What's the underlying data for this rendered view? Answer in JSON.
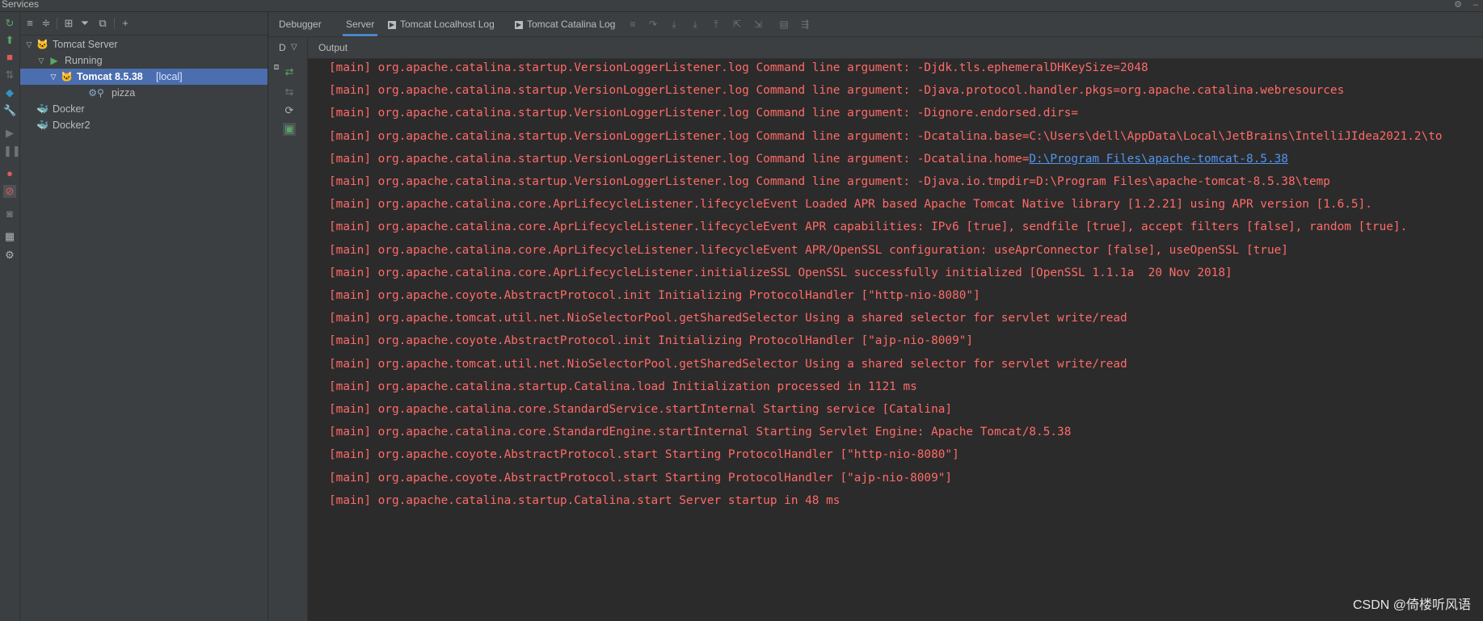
{
  "window": {
    "title": "Services"
  },
  "left_strip": {
    "icons": [
      "rerun-icon",
      "deploy-icon",
      "stop-icon",
      "update-icon",
      "jump-icon",
      "wrench-icon",
      "resume-icon",
      "pause-icon",
      "coverage-icon",
      "profiler-icon",
      "camera-icon",
      "layout-icon",
      "settings-icon"
    ]
  },
  "tree_toolbar": {
    "icons": [
      "expand-all-icon",
      "collapse-all-icon",
      "group-icon",
      "filter-icon",
      "new-tab-icon",
      "add-icon"
    ]
  },
  "tree": {
    "tomcat_server": "Tomcat Server",
    "running": "Running",
    "tomcat_instance": "Tomcat 8.5.38",
    "tomcat_instance_suffix": "[local]",
    "artifact": "pizza",
    "docker": "Docker",
    "docker2": "Docker2"
  },
  "tabs": {
    "debugger": "Debugger",
    "server": "Server",
    "localhost_log": "Tomcat Localhost Log",
    "catalina_log": "Tomcat Catalina Log"
  },
  "subbar": {
    "deployment_label": "D",
    "output_label": "Output"
  },
  "console": {
    "prefix": "[main] ",
    "lines": [
      "org.apache.catalina.startup.VersionLoggerListener.log Command line argument: -Djdk.tls.ephemeralDHKeySize=2048",
      "org.apache.catalina.startup.VersionLoggerListener.log Command line argument: -Djava.protocol.handler.pkgs=org.apache.catalina.webresources",
      "org.apache.catalina.startup.VersionLoggerListener.log Command line argument: -Dignore.endorsed.dirs=",
      "org.apache.catalina.startup.VersionLoggerListener.log Command line argument: -Dcatalina.base=C:\\Users\\dell\\AppData\\Local\\JetBrains\\IntelliJIdea2021.2\\to",
      "org.apache.catalina.startup.VersionLoggerListener.log Command line argument: -Dcatalina.home=",
      "org.apache.catalina.startup.VersionLoggerListener.log Command line argument: -Djava.io.tmpdir=D:\\Program Files\\apache-tomcat-8.5.38\\temp",
      "org.apache.catalina.core.AprLifecycleListener.lifecycleEvent Loaded APR based Apache Tomcat Native library [1.2.21] using APR version [1.6.5].",
      "org.apache.catalina.core.AprLifecycleListener.lifecycleEvent APR capabilities: IPv6 [true], sendfile [true], accept filters [false], random [true].",
      "org.apache.catalina.core.AprLifecycleListener.lifecycleEvent APR/OpenSSL configuration: useAprConnector [false], useOpenSSL [true]",
      "org.apache.catalina.core.AprLifecycleListener.initializeSSL OpenSSL successfully initialized [OpenSSL 1.1.1a  20 Nov 2018]",
      "org.apache.coyote.AbstractProtocol.init Initializing ProtocolHandler [\"http-nio-8080\"]",
      "org.apache.tomcat.util.net.NioSelectorPool.getSharedSelector Using a shared selector for servlet write/read",
      "org.apache.coyote.AbstractProtocol.init Initializing ProtocolHandler [\"ajp-nio-8009\"]",
      "org.apache.tomcat.util.net.NioSelectorPool.getSharedSelector Using a shared selector for servlet write/read",
      "org.apache.catalina.startup.Catalina.load Initialization processed in 1121 ms",
      "org.apache.catalina.core.StandardService.startInternal Starting service [Catalina]",
      "org.apache.catalina.core.StandardEngine.startInternal Starting Servlet Engine: Apache Tomcat/8.5.38",
      "org.apache.coyote.AbstractProtocol.start Starting ProtocolHandler [\"http-nio-8080\"]",
      "org.apache.coyote.AbstractProtocol.start Starting ProtocolHandler [\"ajp-nio-8009\"]",
      "org.apache.catalina.startup.Catalina.start Server startup in 48 ms"
    ],
    "catalina_home_link": "D:\\Program Files\\apache-tomcat-8.5.38"
  },
  "watermark": "CSDN @倚楼听风语",
  "colors": {
    "error_text": "#ff6b68",
    "link": "#5394ec",
    "selection": "#4b6eaf",
    "panel_bg": "#3c3f41",
    "editor_bg": "#2b2b2b"
  }
}
